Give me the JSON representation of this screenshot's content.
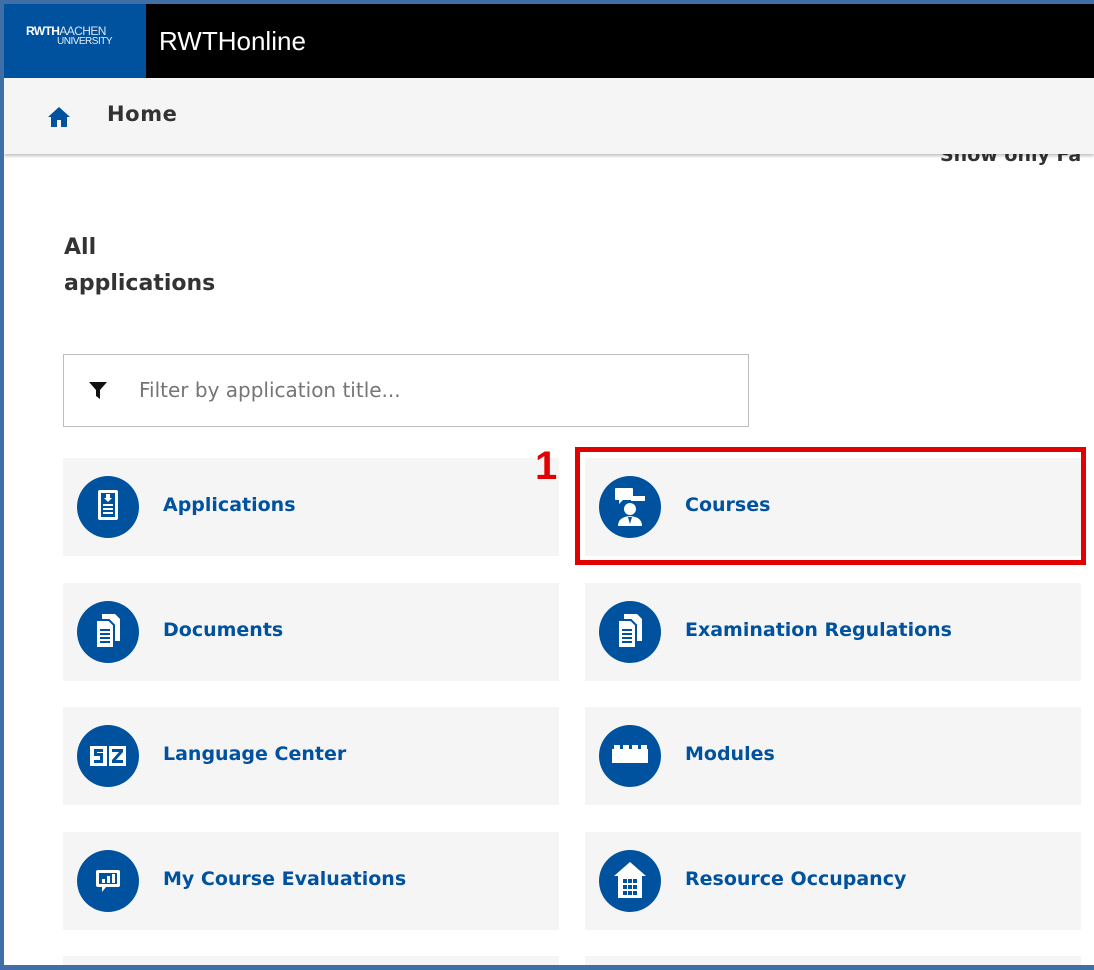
{
  "header": {
    "logo_line1_bold": "RWTH",
    "logo_line1_thin": "AACHEN",
    "logo_line2": "UNIVERSITY",
    "app_title": "RWTHonline"
  },
  "nav": {
    "home_label": "Home",
    "favorites_toggle_label": "Show only Fa"
  },
  "main": {
    "heading_line1": "All",
    "heading_line2": "applications",
    "filter_placeholder": "Filter by application title...",
    "tiles": [
      {
        "label": "Applications",
        "icon": "applications-document-icon"
      },
      {
        "label": "Courses",
        "icon": "courses-lecturer-icon"
      },
      {
        "label": "Documents",
        "icon": "documents-icon"
      },
      {
        "label": "Examination Regulations",
        "icon": "examination-regulations-document-icon"
      },
      {
        "label": "Language Center",
        "icon": "language-center-sz-icon"
      },
      {
        "label": "Modules",
        "icon": "modules-block-icon"
      },
      {
        "label": "My Course Evaluations",
        "icon": "course-evaluation-chart-icon"
      },
      {
        "label": "Resource Occupancy",
        "icon": "building-icon"
      }
    ]
  },
  "annotation": {
    "number": "1",
    "color": "#e30000"
  },
  "colors": {
    "brand_blue": "#00529f",
    "topbar_bg": "#000000",
    "tile_bg": "#f5f5f5"
  }
}
